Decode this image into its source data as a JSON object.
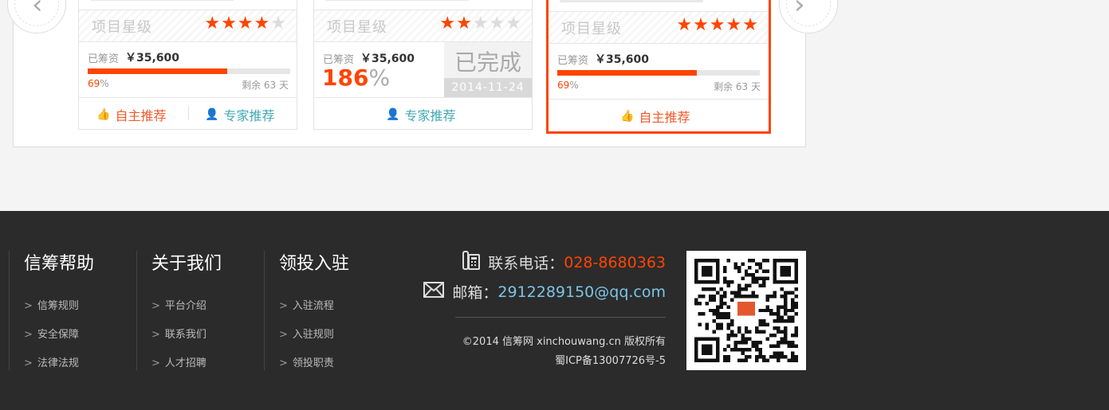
{
  "projects": [
    {
      "rating_label": "项目星级",
      "stars": 4,
      "raised_label": "已筹资",
      "raised_amount": "￥35,600",
      "progress_percent": 69,
      "pct_num": "69",
      "pct_sym": "%",
      "remain_label": "剩余 63 天",
      "actions": [
        "自主推荐",
        "专家推荐"
      ]
    },
    {
      "rating_label": "项目星级",
      "stars": 2,
      "raised_label": "已筹资",
      "raised_amount": "￥35,600",
      "big_pct": "186",
      "pct_sym": "%",
      "status": "已完成",
      "date": "2014-11-24",
      "actions": [
        "专家推荐"
      ]
    },
    {
      "rating_label": "项目星级",
      "stars": 5,
      "raised_label": "已筹资",
      "raised_amount": "￥35,600",
      "progress_percent": 69,
      "pct_num": "69",
      "pct_sym": "%",
      "remain_label": "剩余 63 天",
      "actions": [
        "自主推荐"
      ]
    }
  ],
  "footer": {
    "columns": [
      {
        "title": "信筹帮助",
        "links": [
          "信筹规则",
          "安全保障",
          "法律法规"
        ]
      },
      {
        "title": "关于我们",
        "links": [
          "平台介绍",
          "联系我们",
          "人才招聘"
        ]
      },
      {
        "title": "领投入驻",
        "links": [
          "入驻流程",
          "入驻规则",
          "领投职责"
        ]
      }
    ],
    "link_prefix": ">",
    "phone_label": "联系电话：",
    "phone": "028-8680363",
    "email_label": "邮箱：",
    "email": "2912289150@qq.com",
    "copyright": "©2014 信筹网 xinchouwang.cn 版权所有",
    "icp": "蜀ICP备13007726号-5"
  },
  "colors": {
    "accent": "#ff4400",
    "expert": "#41a9b4",
    "footer_bg": "#2b2b2b",
    "email": "#7cc4e6"
  },
  "icons": {
    "nav_prev": "chevron-left-icon",
    "nav_next": "chevron-right-icon",
    "self_recommend": "thumbs-up-icon",
    "expert_recommend": "person-icon",
    "phone": "phone-icon",
    "mail": "mail-icon",
    "qr": "qr-code"
  }
}
